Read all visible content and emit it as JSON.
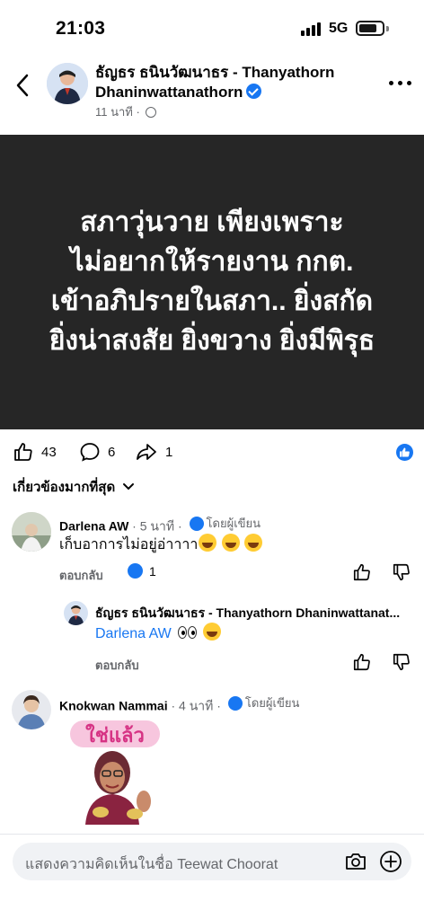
{
  "status_bar": {
    "time": "21:03",
    "network": "5G"
  },
  "post": {
    "author": "ธัญธร ธนินวัฒนาธร - Thanyathorn Dhaninwattanathorn",
    "author_line1": "ธัญธร ธนินวัฒนาธร - Thanyathorn",
    "author_line2": "Dhaninwattanathorn",
    "time": "11 นาที",
    "text_lines": [
      "สภาวุ่นวาย เพียงเพราะ",
      "ไม่อยากให้รายงาน กกต.",
      "เข้าอภิปรายในสภา.. ยิ่งสกัด",
      "ยิ่งน่าสงสัย ยิ่งขวาง ยิ่งมีพิรุธ"
    ],
    "background_color": "#262626"
  },
  "reactions": {
    "likes": "43",
    "comments": "6",
    "shares": "1"
  },
  "sort_label": "เกี่ยวข้องมากที่สุด",
  "comments": [
    {
      "name": "Darlena AW",
      "time": "5 นาที",
      "author_badge": "โดยผู้เขียน",
      "text": "เก็บอาการไม่อยู่อ่าาาา",
      "reply_label": "ตอบกลับ",
      "like_count": "1"
    },
    {
      "name": "ธัญธร ธนินวัฒนาธร - Thanyathorn Dhaninwattanat...",
      "mention": "Darlena AW",
      "reply_label": "ตอบกลับ"
    },
    {
      "name": "Knokwan Nammai",
      "time": "4 นาที",
      "author_badge": "โดยผู้เขียน",
      "sticker_text": "ใช่แล้ว"
    }
  ],
  "comment_input": {
    "placeholder": "แสดงความคิดเห็นในชื่อ Teewat Choorat"
  },
  "colors": {
    "accent": "#1877f2",
    "secondary_text": "#65676b"
  }
}
